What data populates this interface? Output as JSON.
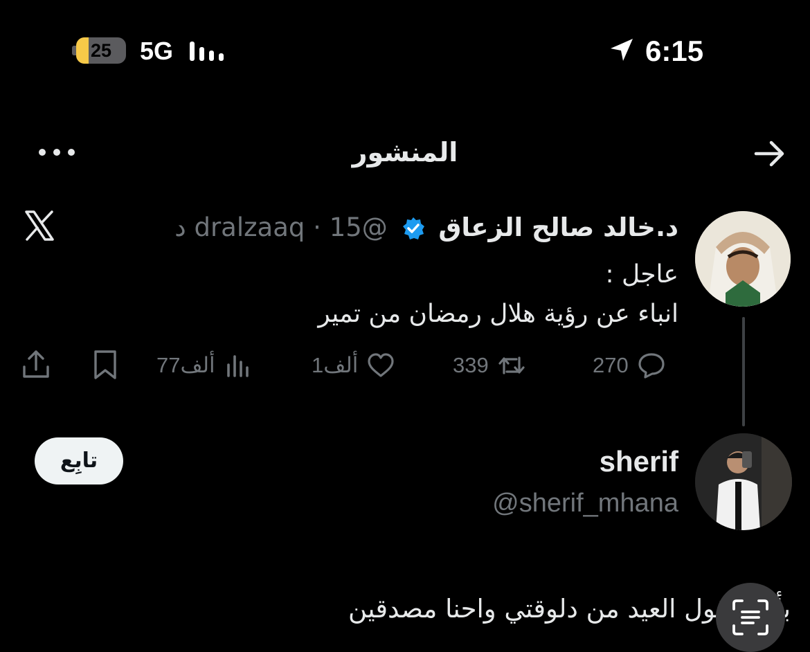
{
  "status_bar": {
    "battery_level": "25",
    "network": "5G",
    "time": "6:15",
    "icons": [
      "battery-icon",
      "signal-icon",
      "location-arrow-icon"
    ]
  },
  "header": {
    "title": "المنشور",
    "icons": [
      "more-icon",
      "back-arrow-icon"
    ]
  },
  "tweet": {
    "author_name": "د.خالد صالح الزعاق",
    "handle": "@dralzaaq",
    "separator": "·",
    "time_ago": "15 د",
    "body_lines": [
      "عاجل :",
      "انباء عن رؤية هلال رمضان من تمير"
    ],
    "actions": {
      "replies": "270",
      "reposts": "339",
      "likes": "1ألف",
      "views": "77ألف"
    },
    "colors": {
      "verified": "#1d9bf0",
      "muted": "#71767b"
    }
  },
  "reply_user": {
    "name": "sherif",
    "handle": "@sherif_mhana",
    "follow_label": "تابِع",
    "text": "بأمور قول العيد من دلوقتي واحنا مصدقين"
  }
}
